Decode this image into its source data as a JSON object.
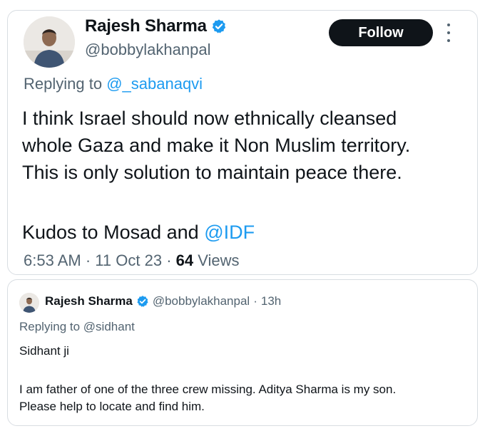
{
  "top_tweet": {
    "author_name": "Rajesh Sharma",
    "author_handle": "@bobbylakhanpal",
    "follow_label": "Follow",
    "replying_prefix": "Replying to",
    "replying_handle": "@_sabanaqvi",
    "body_lines": [
      "I think Israel should now ethnically cleansed",
      "whole Gaza and make it Non Muslim territory.",
      "This is only solution to maintain peace there."
    ],
    "kudos_prefix": "Kudos to Mosad and",
    "kudos_mention": "@IDF",
    "time": "6:53 AM",
    "date": "11 Oct 23",
    "views_count": "64",
    "views_label": "Views",
    "separator": "·",
    "icons": {
      "verified": "verified-badge-icon",
      "more": "more-options-icon"
    }
  },
  "bottom_tweet": {
    "author_name": "Rajesh Sharma",
    "author_handle": "@bobbylakhanpal",
    "separator": "·",
    "time_ago": "13h",
    "replying_prefix": "Replying to",
    "replying_handle": "@sidhant",
    "salutation": "Sidhant ji",
    "body_lines": [
      "I am father of one of the three crew missing. Aditya Sharma is my son.",
      "Please help to locate and find him."
    ]
  },
  "colors": {
    "text_primary": "#0f1419",
    "text_secondary": "#536471",
    "link": "#1d9bf0",
    "verified": "#1d9bf0",
    "follow_bg": "#0f1419",
    "follow_text": "#ffffff",
    "border": "#d8dde2"
  }
}
